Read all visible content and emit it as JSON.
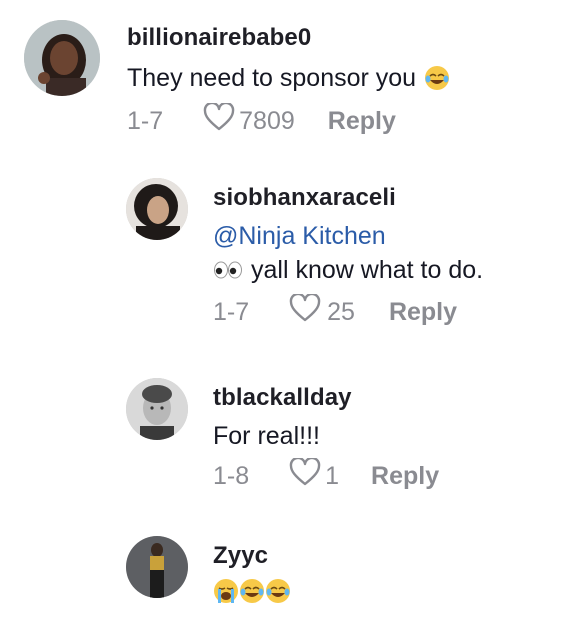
{
  "comments": [
    {
      "username": "billionairebabe0",
      "text": "They need to sponsor you",
      "text_emoji": "face-with-tears-of-joy",
      "date": "1-7",
      "likes": "7809",
      "reply_label": "Reply"
    },
    {
      "username": "siobhanxaraceli",
      "mention": "@Ninja Kitchen",
      "text_emoji": "eyes",
      "text": "yall know what to do.",
      "date": "1-7",
      "likes": "25",
      "reply_label": "Reply"
    },
    {
      "username": "tblackallday",
      "text": "For real!!!",
      "date": "1-8",
      "likes": "1",
      "reply_label": "Reply"
    },
    {
      "username": "Zyyc",
      "text_emojis": [
        "loudly-crying-face",
        "face-with-tears-of-joy",
        "face-with-tears-of-joy"
      ]
    }
  ],
  "colors": {
    "username": "#1f1f26",
    "text": "#161823",
    "mention": "#2b5ca8",
    "meta": "#8a8b91"
  }
}
